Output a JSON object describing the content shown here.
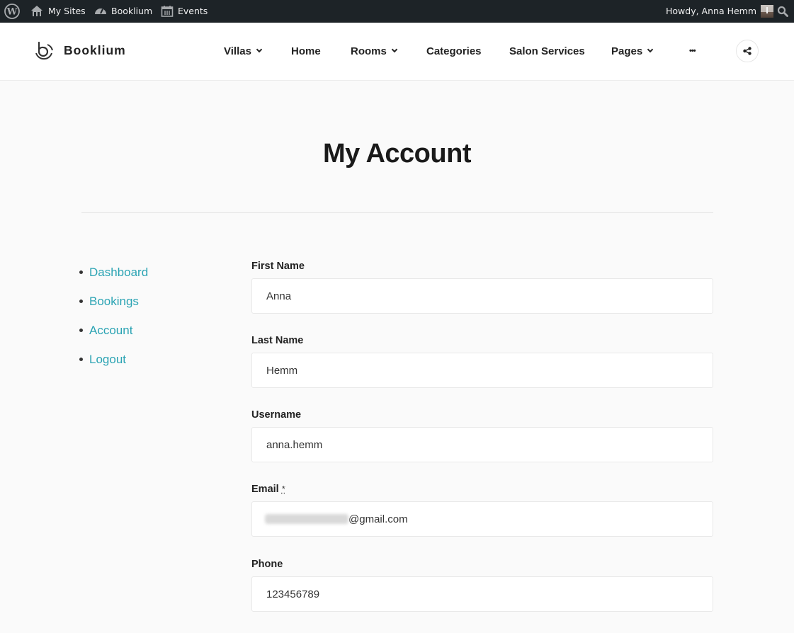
{
  "adminbar": {
    "wp_logo": "wordpress-icon",
    "items": [
      {
        "label": "My Sites",
        "icon": "my-sites-icon"
      },
      {
        "label": "Booklium",
        "icon": "dashboard-icon"
      },
      {
        "label": "Events",
        "icon": "calendar-icon"
      }
    ],
    "howdy": "Howdy, Anna Hemm",
    "search_icon": "search-icon"
  },
  "header": {
    "logo_text": "Booklium",
    "nav": [
      {
        "label": "Villas",
        "dropdown": true
      },
      {
        "label": "Home",
        "dropdown": false
      },
      {
        "label": "Rooms",
        "dropdown": true
      },
      {
        "label": "Categories",
        "dropdown": false
      },
      {
        "label": "Salon Services",
        "dropdown": false
      },
      {
        "label": "Pages",
        "dropdown": true
      },
      {
        "label": "•••",
        "dropdown": false
      }
    ],
    "share_icon": "share-icon"
  },
  "page": {
    "title": "My Account"
  },
  "account_nav": [
    {
      "label": "Dashboard"
    },
    {
      "label": "Bookings"
    },
    {
      "label": "Account"
    },
    {
      "label": "Logout"
    }
  ],
  "form": {
    "fields": [
      {
        "label": "First Name",
        "value": "Anna"
      },
      {
        "label": "Last Name",
        "value": "Hemm"
      },
      {
        "label": "Username",
        "value": "anna.hemm"
      },
      {
        "label": "Email",
        "required_mark": "*",
        "value_visible": "@gmail.com"
      },
      {
        "label": "Phone",
        "value": "123456789"
      }
    ]
  },
  "colors": {
    "link": "#2aa3b3",
    "adminbar": "#1d2327"
  }
}
